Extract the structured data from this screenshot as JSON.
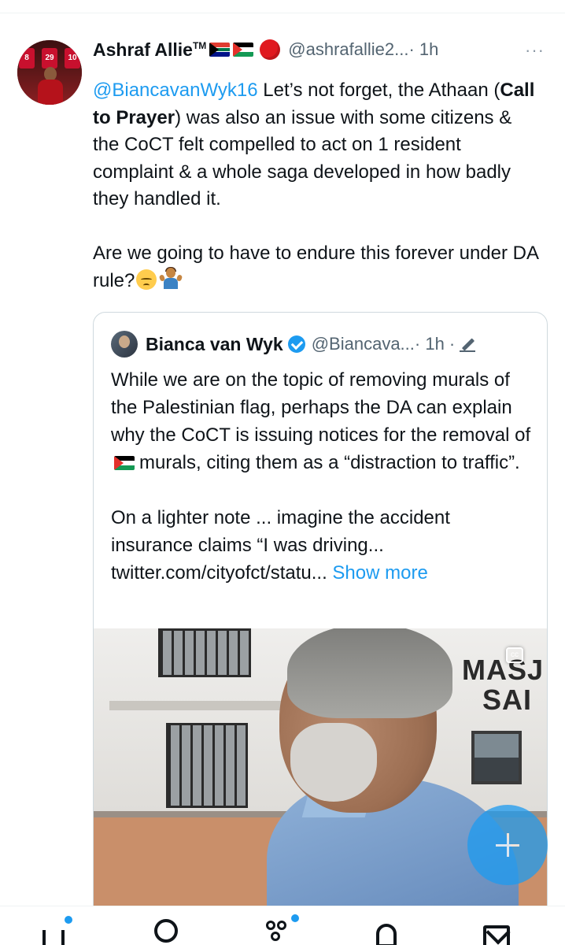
{
  "tweet": {
    "author_name": "Ashraf Allie",
    "author_name_suffix": "TM",
    "author_handle": "@ashrafallie2...",
    "time": "· 1h",
    "more_label": "···",
    "mention": "@BiancavanWyk16",
    "text_part1": " Let’s not forget, the Athaan (",
    "text_bold": "Call to Prayer",
    "text_part2": ") was also an issue with some citizens & the CoCT felt compelled to act on 1 resident complaint & a whole saga developed in how badly they handled it.",
    "text_para2": "Are we going to have to endure this forever under DA rule?",
    "badge_icons": [
      "south-africa-flag-icon",
      "palestine-flag-icon",
      "red-circle-icon"
    ],
    "end_emojis": [
      "pensive-face-icon",
      "person-shrugging-icon"
    ],
    "avatar_shirt_numbers": [
      "8",
      "29",
      "10"
    ]
  },
  "quote": {
    "author_name": "Bianca van Wyk",
    "author_handle": "@Biancava...",
    "time": "· 1h ·",
    "text_part1": "While we are on the topic of removing murals of the Palestinian flag, perhaps the DA can explain why the CoCT is issuing notices for the removal of",
    "text_part2": "murals, citing them as a “distraction to traffic”.",
    "text_para2": "On a lighter note ... imagine the accident insurance claims “I was driving...",
    "link": "twitter.com/cityofct/statu...",
    "show_more": "Show more",
    "media": {
      "sign_line1": "MASJ",
      "sign_line2": "SAI",
      "cc_label": "cc"
    }
  },
  "fab": {
    "icon": "plus-icon"
  },
  "nav": {
    "items": [
      "home-icon",
      "search-icon",
      "communities-icon",
      "notifications-icon",
      "messages-icon"
    ]
  },
  "colors": {
    "accent": "#1d9bf0",
    "text": "#0f1419",
    "secondary": "#536471",
    "border": "#cfd9de"
  }
}
